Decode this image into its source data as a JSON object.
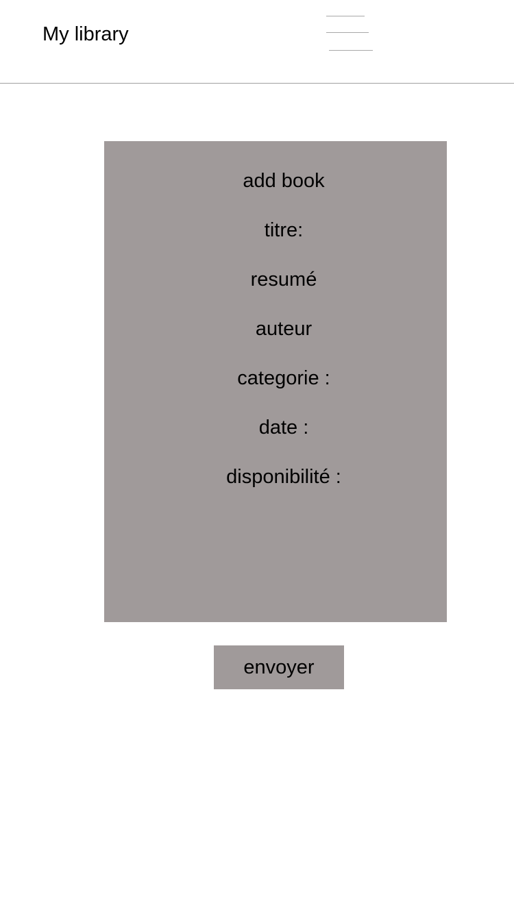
{
  "header": {
    "title": "My library",
    "menu_icon": "hamburger-menu-icon"
  },
  "form": {
    "heading": "add book",
    "fields": [
      {
        "label": "titre:"
      },
      {
        "label": "resumé"
      },
      {
        "label": "auteur"
      },
      {
        "label": "categorie :"
      },
      {
        "label": "date :"
      },
      {
        "label": "disponibilité :"
      }
    ],
    "submit_label": "envoyer"
  },
  "colors": {
    "card_background": "#a09a9a",
    "button_background": "#a09a9a",
    "divider": "#a0a0a0",
    "text": "#000000"
  }
}
